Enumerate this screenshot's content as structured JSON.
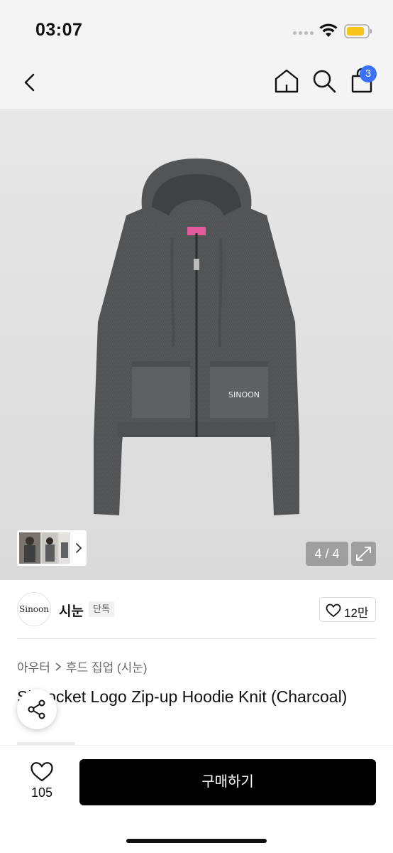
{
  "status_bar": {
    "time": "03:07",
    "wifi_icon": "wifi-icon",
    "battery_icon": "battery-icon"
  },
  "nav": {
    "back_icon": "chevron-left-icon",
    "home_icon": "home-icon",
    "search_icon": "search-icon",
    "cart_icon": "shopping-bag-icon",
    "cart_badge": "3"
  },
  "gallery": {
    "page_counter": "4 / 4",
    "expand_icon": "expand-icon",
    "thumb_arrow_icon": "chevron-right-icon",
    "pocket_logo": "SINOON"
  },
  "brand": {
    "logo_text": "Sinoon",
    "name": "시눈",
    "tag": "단독",
    "likes": "12만"
  },
  "breadcrumb": {
    "category": "아우터",
    "subcategory": "후드 집업 (시눈)"
  },
  "product": {
    "title": "Si Pocket Logo Zip-up Hoodie Knit (Charcoal)"
  },
  "share": {
    "icon": "share-icon"
  },
  "bottom_bar": {
    "wish_count": "105",
    "buy_label": "구매하기"
  },
  "colors": {
    "accent": "#3a6ff7",
    "buy_button": "#000000",
    "hoodie": "#555759"
  }
}
